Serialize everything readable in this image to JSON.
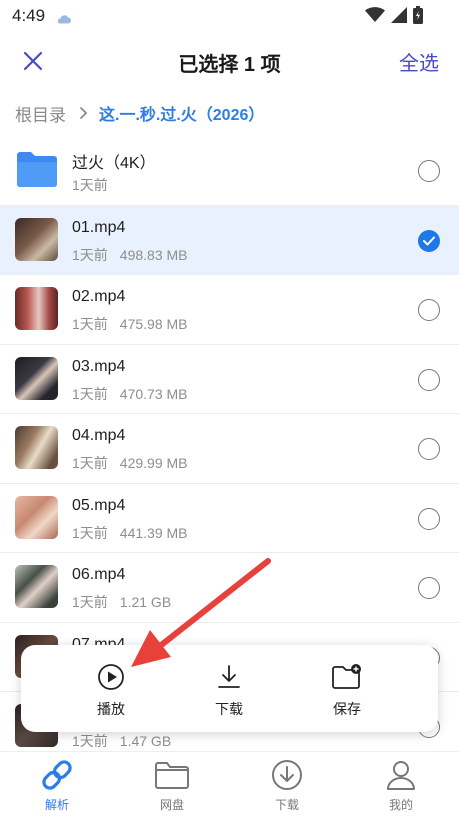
{
  "status_bar": {
    "time": "4:49"
  },
  "nav": {
    "title": "已选择 1 项",
    "select_all": "全选"
  },
  "breadcrumb": {
    "root": "根目录",
    "current": "这.一.秒.过.火（2026）"
  },
  "files": [
    {
      "name": "过火（4K）",
      "time": "1天前",
      "size": "",
      "kind": "folder",
      "selected": false
    },
    {
      "name": "01.mp4",
      "time": "1天前",
      "size": "498.83 MB",
      "kind": "video",
      "selected": true
    },
    {
      "name": "02.mp4",
      "time": "1天前",
      "size": "475.98 MB",
      "kind": "video",
      "selected": false
    },
    {
      "name": "03.mp4",
      "time": "1天前",
      "size": "470.73 MB",
      "kind": "video",
      "selected": false
    },
    {
      "name": "04.mp4",
      "time": "1天前",
      "size": "429.99 MB",
      "kind": "video",
      "selected": false
    },
    {
      "name": "05.mp4",
      "time": "1天前",
      "size": "441.39 MB",
      "kind": "video",
      "selected": false
    },
    {
      "name": "06.mp4",
      "time": "1天前",
      "size": "1.21 GB",
      "kind": "video",
      "selected": false
    },
    {
      "name": "07.mp4",
      "time": "",
      "size": "",
      "kind": "video",
      "selected": false
    },
    {
      "name": "",
      "time": "1天前",
      "size": "1.47 GB",
      "kind": "video",
      "selected": false
    }
  ],
  "actions": {
    "play": "播放",
    "download": "下载",
    "save": "保存"
  },
  "tabs": {
    "parse": "解析",
    "cloud": "网盘",
    "download": "下载",
    "mine": "我的"
  },
  "colors": {
    "accent": "#2b7de9",
    "select_all": "#4a49c8",
    "selected_row": "#e8f1fd",
    "annotation_arrow": "#e8413c"
  }
}
